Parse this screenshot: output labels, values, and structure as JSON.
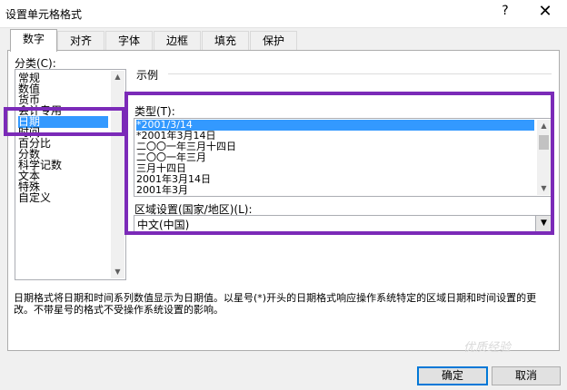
{
  "window": {
    "title": "设置单元格格式",
    "help": "?",
    "close": "✕"
  },
  "tabs": [
    {
      "label": "数字",
      "active": true
    },
    {
      "label": "对齐"
    },
    {
      "label": "字体"
    },
    {
      "label": "边框"
    },
    {
      "label": "填充"
    },
    {
      "label": "保护"
    }
  ],
  "category": {
    "label": "分类(C):",
    "items": [
      "常规",
      "数值",
      "货币",
      "会计专用",
      "日期",
      "时间",
      "百分比",
      "分数",
      "科学记数",
      "文本",
      "特殊",
      "自定义"
    ],
    "selected": "日期"
  },
  "sample": {
    "label": "示例"
  },
  "type": {
    "label": "类型(T):",
    "items": [
      "*2001/3/14",
      "*2001年3月14日",
      "二〇〇一年三月十四日",
      "二〇〇一年三月",
      "三月十四日",
      "2001年3月14日",
      "2001年3月"
    ],
    "selected": "*2001/3/14"
  },
  "locale": {
    "label": "区域设置(国家/地区)(L):",
    "value": "中文(中国)"
  },
  "description": "日期格式将日期和时间系列数值显示为日期值。以星号(*)开头的日期格式响应操作系统特定的区域日期和时间设置的更改。不带星号的格式不受操作系统设置的影响。",
  "buttons": {
    "ok": "确定",
    "cancel": "取消"
  },
  "watermark": "优质经验",
  "colors": {
    "highlight": "#7b2ab8",
    "selection": "#3399ff",
    "default_button_border": "#0078d7"
  }
}
